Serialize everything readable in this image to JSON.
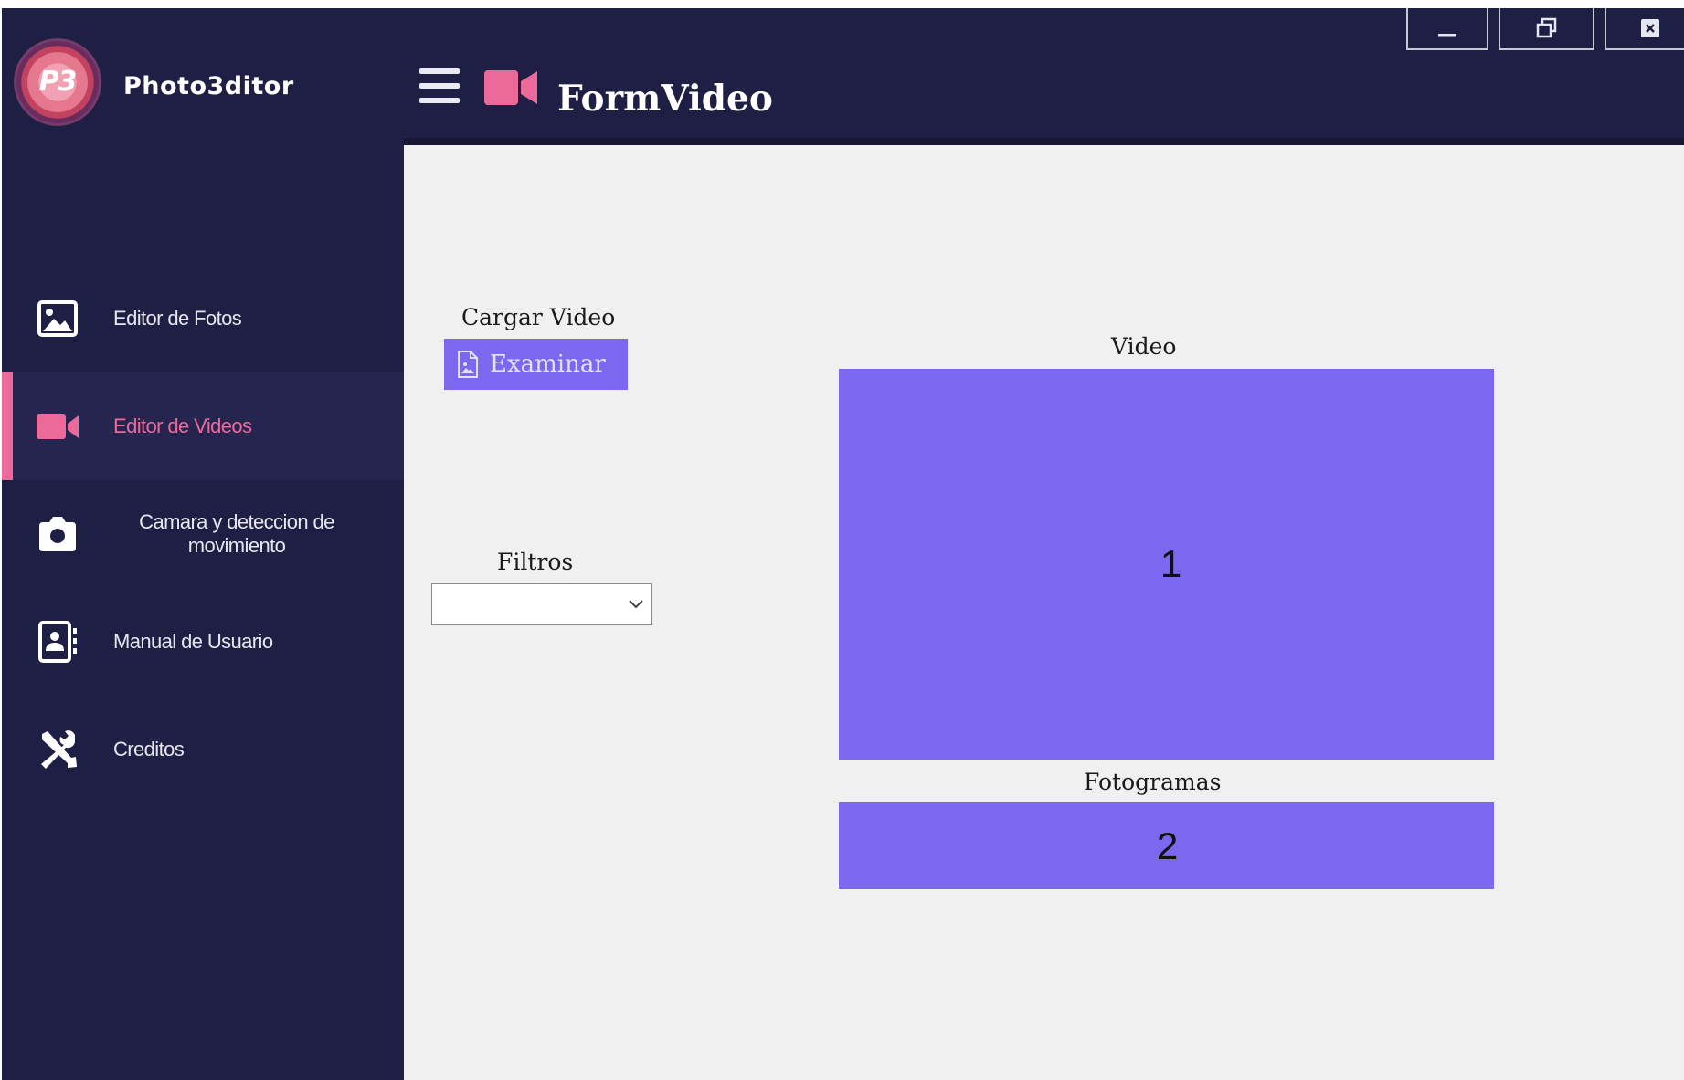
{
  "app": {
    "logo_text": "P3",
    "name": "Photo3ditor",
    "logo_icon": "p3-logo-icon"
  },
  "header": {
    "menu_icon": "hamburger-icon",
    "form_icon": "video-camera-icon",
    "title": "FormVideo"
  },
  "window_controls": {
    "minimize_icon": "minimize-icon",
    "restore_icon": "restore-icon",
    "close_icon": "close-icon"
  },
  "sidebar": {
    "items": [
      {
        "label": "Editor de Fotos",
        "icon": "image-icon",
        "active": false
      },
      {
        "label": "Editor de Videos",
        "icon": "video-camera-icon",
        "active": true
      },
      {
        "label": "Camara y deteccion de movimiento",
        "icon": "camera-icon",
        "active": false
      },
      {
        "label": "Manual de Usuario",
        "icon": "user-manual-icon",
        "active": false
      },
      {
        "label": "Creditos",
        "icon": "tools-icon",
        "active": false
      }
    ]
  },
  "main": {
    "load_label": "Cargar Video",
    "browse_button": "Examinar",
    "browse_icon": "file-image-icon",
    "filters_label": "Filtros",
    "filters_value": "",
    "video_label": "Video",
    "video_marker": "1",
    "frames_label": "Fotogramas",
    "frames_marker": "2"
  },
  "colors": {
    "sidebar_bg": "#1f1f45",
    "accent_pink": "#ec6a9a",
    "panel_purple": "#7b68ee",
    "content_bg": "#f0f0f0"
  }
}
